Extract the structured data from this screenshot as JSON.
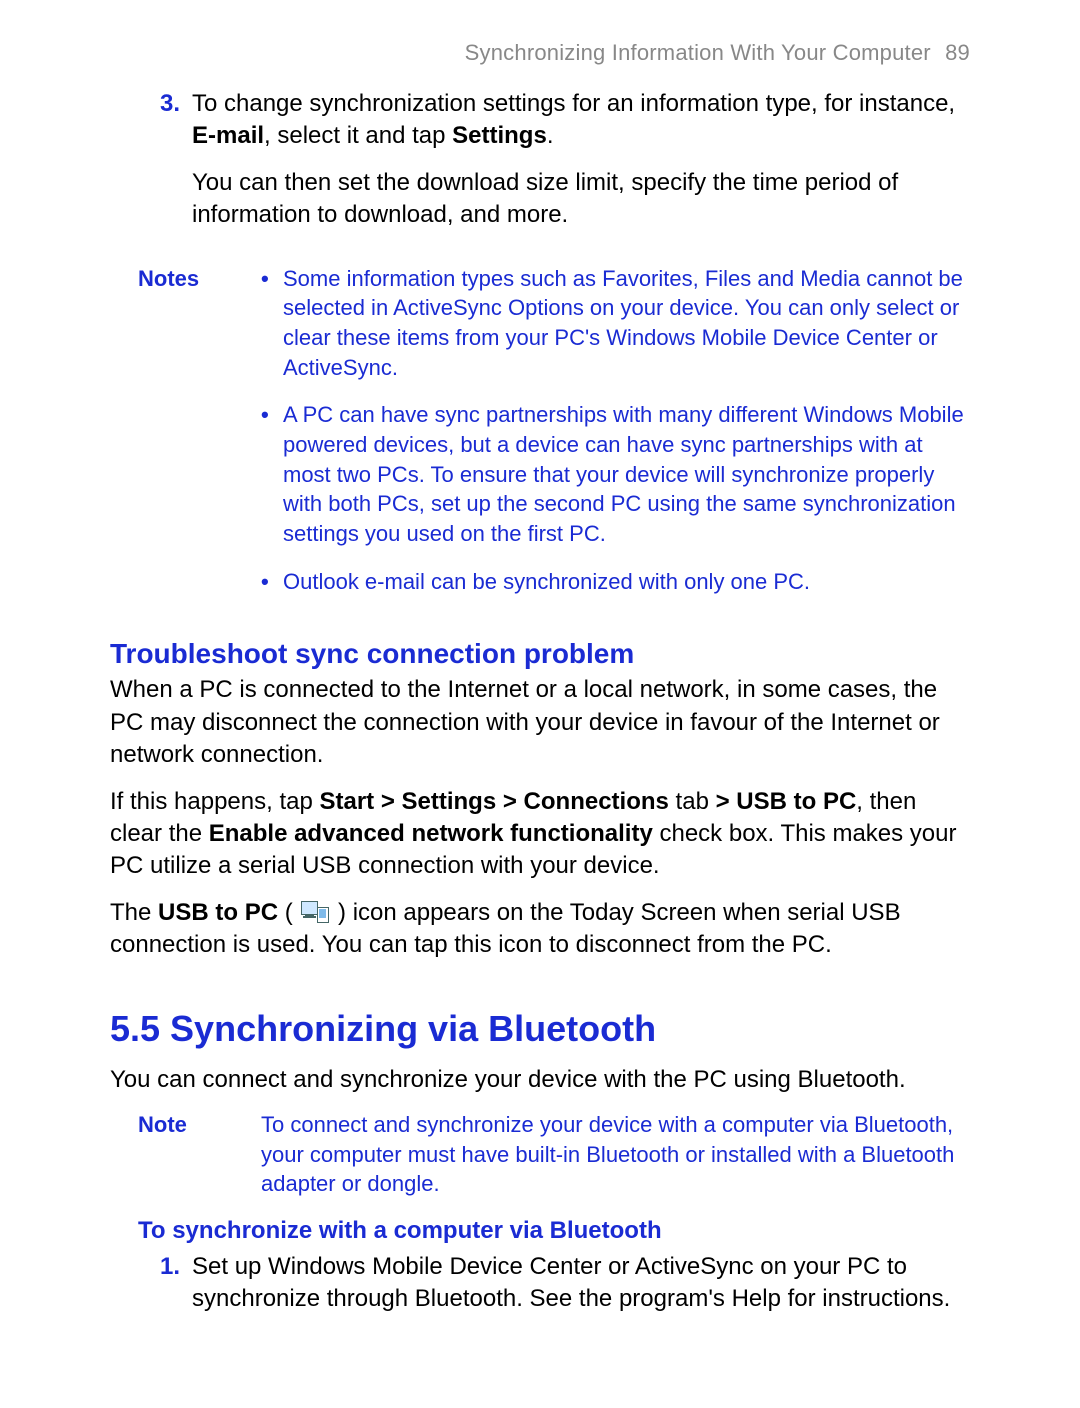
{
  "header": {
    "chapter_title": "Synchronizing Information With Your Computer",
    "page_number": "89"
  },
  "step3": {
    "marker": "3.",
    "para1_pre": "To change synchronization settings for an information type, for instance, ",
    "para1_bold1": "E-mail",
    "para1_mid": ", select it and tap ",
    "para1_bold2": "Settings",
    "para1_post": ".",
    "para2": "You can then set the download size limit, specify the time period of information to download, and more."
  },
  "notes1": {
    "label": "Notes",
    "items": [
      "Some information types such as Favorites, Files and Media cannot be selected in ActiveSync Options on your device. You can only select or clear these items from your PC's Windows Mobile Device Center or ActiveSync.",
      "A PC can have sync partnerships with many different Windows Mobile powered devices, but a device can have sync partnerships with at most two PCs. To ensure that your device will synchronize properly with both PCs, set up the second PC using the same synchronization settings you used on the first PC.",
      "Outlook e-mail can be synchronized with only one PC."
    ]
  },
  "trouble": {
    "heading": "Troubleshoot sync connection problem",
    "p1": "When a PC is connected to the Internet or a local network, in some cases, the PC may disconnect the connection with your device in favour of the Internet or network connection.",
    "p2_pre": "If this happens, tap ",
    "p2_b1": "Start > Settings > Connections",
    "p2_mid1": " tab ",
    "p2_b2": "> USB to PC",
    "p2_mid2": ", then clear the ",
    "p2_b3": "Enable advanced network functionality",
    "p2_post": " check box. This makes your PC utilize a serial USB connection with your device.",
    "p3_pre": "The ",
    "p3_b1": "USB to PC",
    "p3_mid1": " ( ",
    "p3_mid2": " ) icon appears on the Today Screen when serial USB connection is used. You can tap this icon to disconnect from the PC."
  },
  "section55": {
    "heading": "5.5  Synchronizing via Bluetooth",
    "p1": "You can connect and synchronize your device with the PC using Bluetooth."
  },
  "note2": {
    "label": "Note",
    "body": "To connect and synchronize your device with a computer via Bluetooth, your computer must have built-in Bluetooth or installed with a Bluetooth adapter or dongle."
  },
  "proc": {
    "heading": "To synchronize with a computer via Bluetooth",
    "step1_marker": "1.",
    "step1_body": "Set up Windows Mobile Device Center or ActiveSync on your PC to synchronize through Bluetooth. See the program's Help for instructions."
  }
}
